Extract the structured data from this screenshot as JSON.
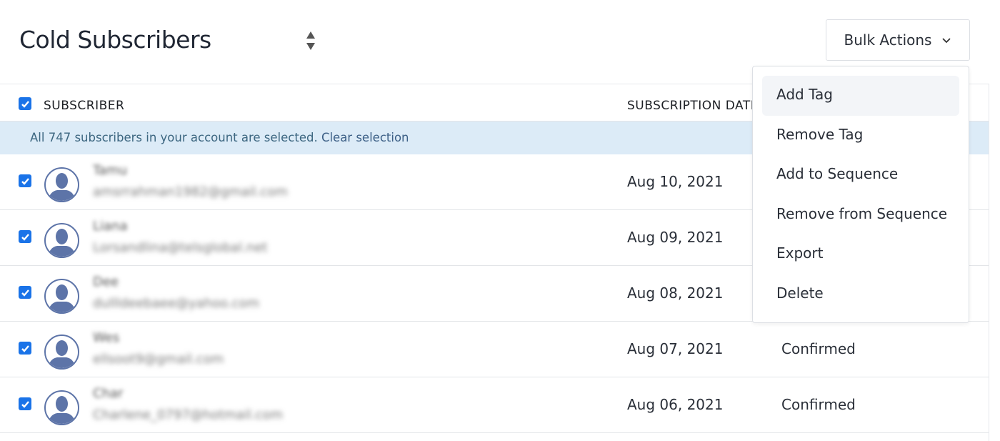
{
  "page": {
    "title": "Cold Subscribers"
  },
  "toolbar": {
    "bulk_actions_label": "Bulk Actions"
  },
  "table": {
    "headers": {
      "subscriber": "SUBSCRIBER",
      "subscription_date": "SUBSCRIPTION DATE"
    },
    "banner": {
      "text": "All 747 subscribers in your account are selected.",
      "clear_link": "Clear selection"
    },
    "rows": [
      {
        "name": "Tamu",
        "email": "amsrrahman1982@gmail.com",
        "date": "Aug 10, 2021",
        "status": "",
        "checked": true
      },
      {
        "name": "Liana",
        "email": "Lorsandlina@telsglobal.net",
        "date": "Aug 09, 2021",
        "status": "",
        "checked": true
      },
      {
        "name": "Dee",
        "email": "dullldeebaee@yahoo.com",
        "date": "Aug 08, 2021",
        "status": "",
        "checked": true
      },
      {
        "name": "Wes",
        "email": "ellsoot9@gmail.com",
        "date": "Aug 07, 2021",
        "status": "Confirmed",
        "checked": true
      },
      {
        "name": "Char",
        "email": "Charlene_0797@hotmail.com",
        "date": "Aug 06, 2021",
        "status": "Confirmed",
        "checked": true
      }
    ]
  },
  "bulk_menu": {
    "items": [
      "Add Tag",
      "Remove Tag",
      "Add to Sequence",
      "Remove from Sequence",
      "Export",
      "Delete"
    ],
    "highlighted": "Add Tag"
  },
  "colors": {
    "checkbox": "#1a73e8",
    "banner_bg": "#dcebf7",
    "avatar": "#5d74a8"
  }
}
